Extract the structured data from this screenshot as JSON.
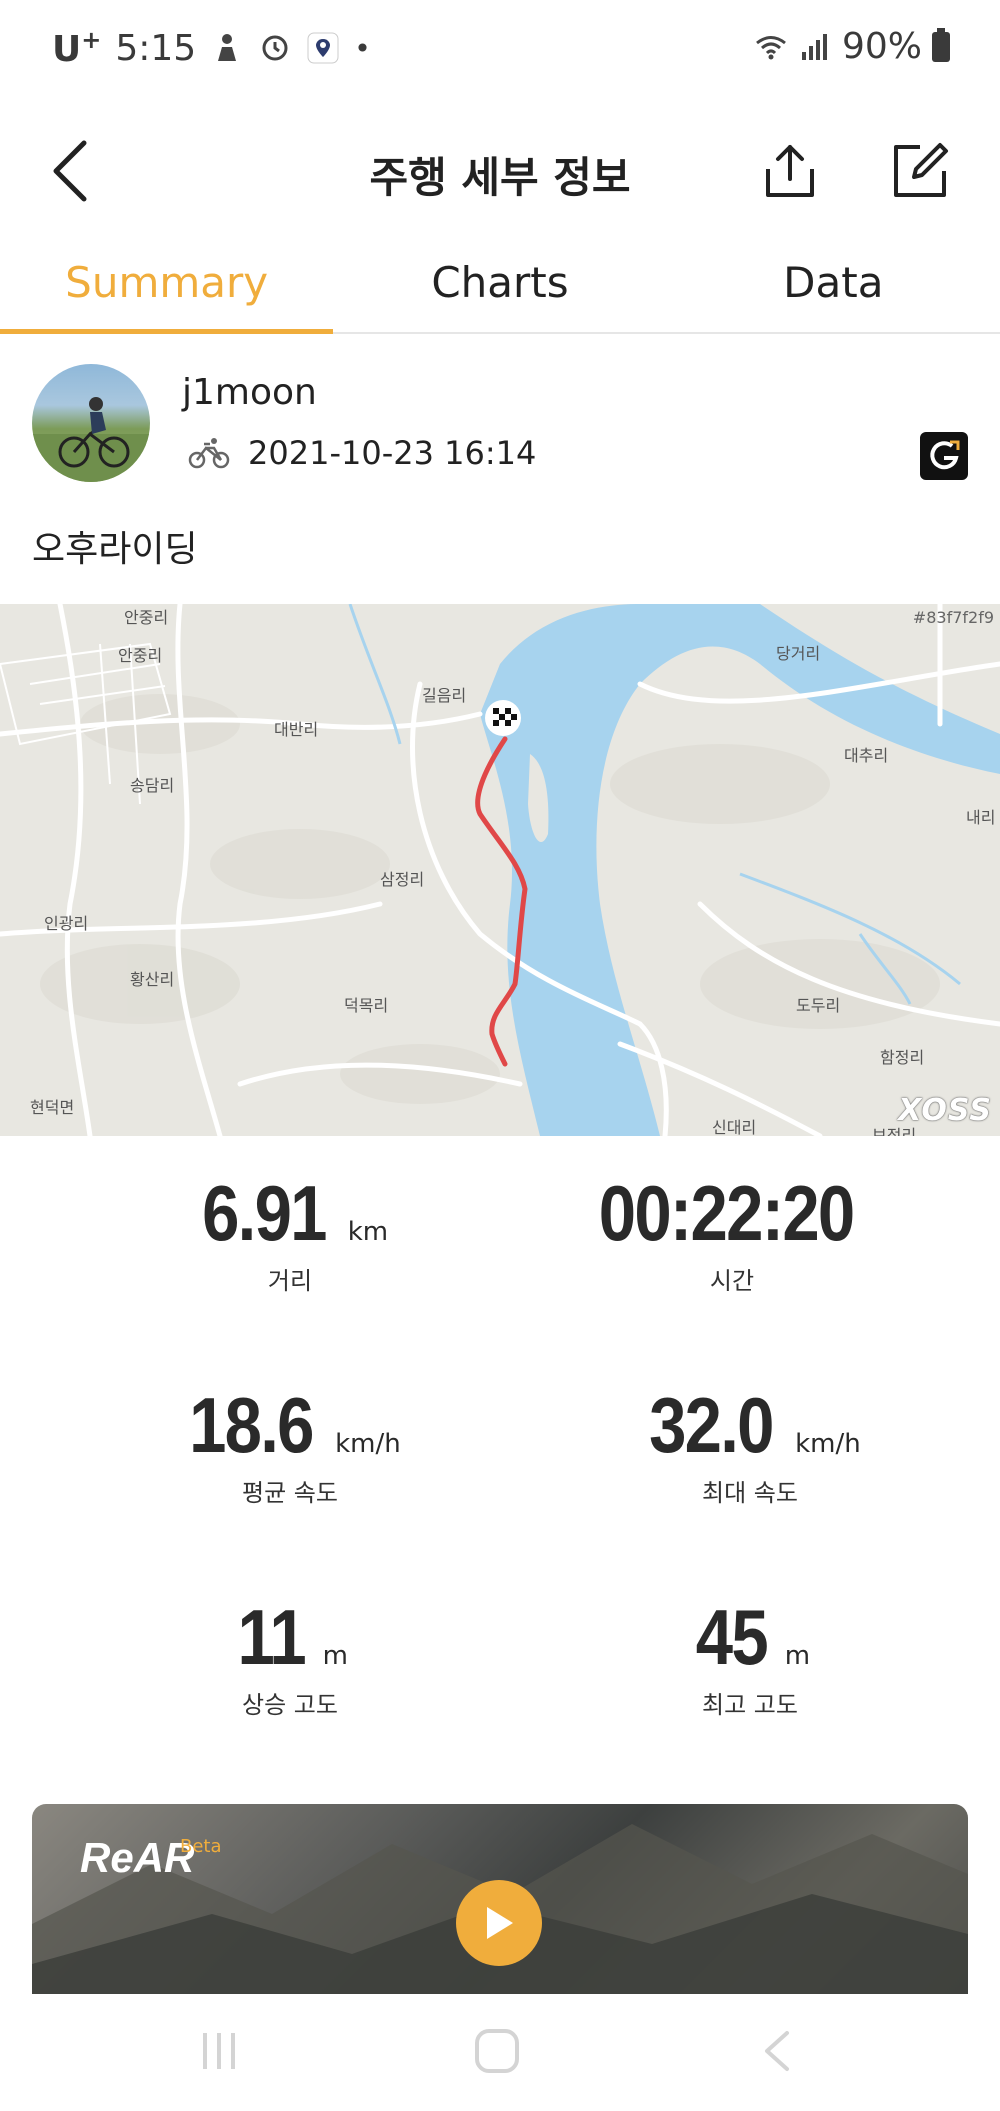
{
  "status_bar": {
    "carrier": "U",
    "carrier_sup": "+",
    "time": "5:15",
    "battery": "90%"
  },
  "header": {
    "title": "주행 세부 정보"
  },
  "tabs": [
    {
      "label": "Summary",
      "active": true
    },
    {
      "label": "Charts",
      "active": false
    },
    {
      "label": "Data",
      "active": false
    }
  ],
  "profile": {
    "username": "j1moon",
    "datetime": "2021-10-23 16:14"
  },
  "ride": {
    "title": "오후라이딩"
  },
  "map": {
    "id_label": "#83f7f2f9",
    "brand": "XOSS",
    "places": [
      "안중리",
      "안중리",
      "대반리",
      "송담리",
      "길음리",
      "당거리",
      "대추리",
      "내리",
      "삼정리",
      "인광리",
      "황산리",
      "덕목리",
      "도두리",
      "함정리",
      "현덕면",
      "신대리",
      "보정리"
    ]
  },
  "stats": [
    {
      "value": "6.91",
      "unit": "km",
      "label": "거리"
    },
    {
      "value": "00:22:20",
      "unit": "",
      "label": "시간"
    },
    {
      "value": "18.6",
      "unit": "km/h",
      "label": "평균 속도"
    },
    {
      "value": "32.0",
      "unit": "km/h",
      "label": "최대 속도"
    },
    {
      "value": "11",
      "unit": "m",
      "label": "상승 고도"
    },
    {
      "value": "45",
      "unit": "m",
      "label": "최고 고도"
    }
  ],
  "rear_card": {
    "logo": "ReAR",
    "badge": "Beta"
  },
  "colors": {
    "accent": "#f0ad3c",
    "route": "#e04848",
    "water": "#a7d3ee"
  }
}
